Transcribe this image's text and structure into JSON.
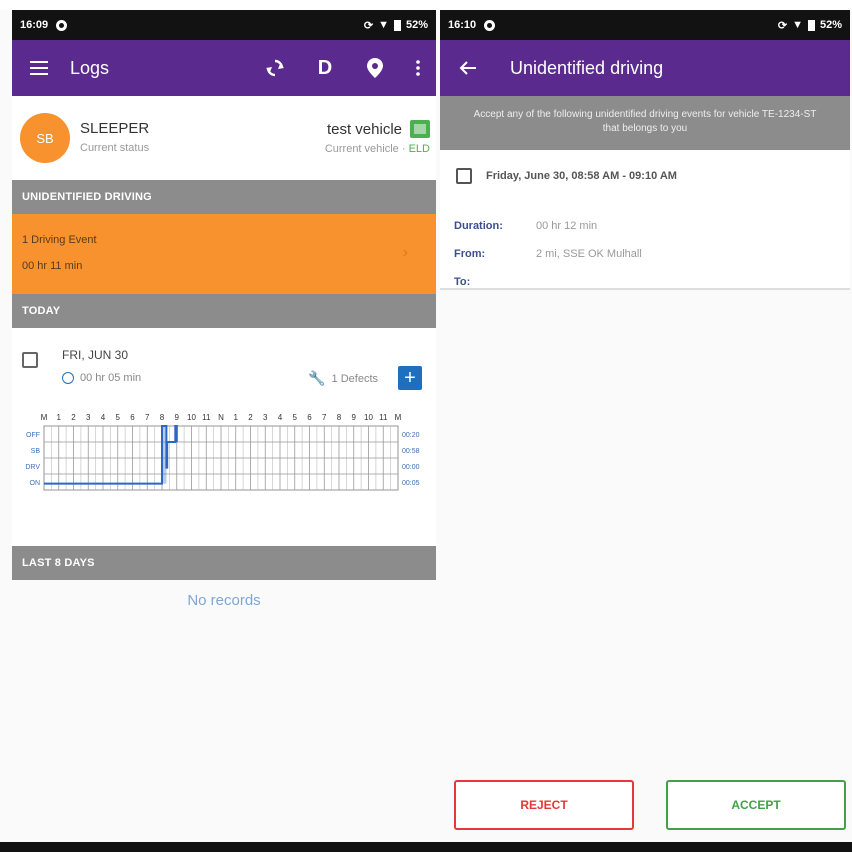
{
  "left": {
    "status_bar": {
      "time": "16:09",
      "battery": "52%"
    },
    "app_bar": {
      "title": "Logs",
      "duty_letter": "D"
    },
    "status_card": {
      "avatar_initials": "SB",
      "status": "SLEEPER",
      "status_caption": "Current status",
      "vehicle": "test vehicle",
      "vehicle_caption": "Current vehicle",
      "eld_label": "ELD"
    },
    "unidentified_section": {
      "header": "UNIDENTIFIED DRIVING",
      "event_count": "1 Driving Event",
      "event_duration": "00 hr 11 min"
    },
    "today_section": {
      "header": "TODAY",
      "date": "FRI, JUN 30",
      "duration": "00 hr 05 min",
      "defects": "1 Defects"
    },
    "log_grid": {
      "hour_labels": [
        "M",
        "1",
        "2",
        "3",
        "4",
        "5",
        "6",
        "7",
        "8",
        "9",
        "10",
        "11",
        "N",
        "1",
        "2",
        "3",
        "4",
        "5",
        "6",
        "7",
        "8",
        "9",
        "10",
        "11",
        "M"
      ],
      "rows": [
        "OFF",
        "SB",
        "DRV",
        "ON"
      ],
      "totals": [
        "00:20",
        "00:58",
        "00:00",
        "00:05"
      ]
    },
    "last8_section": {
      "header": "LAST 8 DAYS",
      "empty_text": "No records"
    }
  },
  "right": {
    "status_bar": {
      "time": "16:10",
      "battery": "52%"
    },
    "app_bar": {
      "title": "Unidentified driving"
    },
    "banner": "Accept any of the following unidentified driving events for vehicle TE-1234-ST that belongs to you",
    "event": {
      "title": "Friday, June 30, 08:58 AM - 09:10 AM",
      "duration_label": "Duration:",
      "duration_value": "00 hr 12 min",
      "from_label": "From:",
      "from_value": "2 mi, SSE OK Mulhall",
      "to_label": "To:"
    },
    "reject_label": "REJECT",
    "accept_label": "ACCEPT"
  },
  "colors": {
    "appbar": "#5b2a8e",
    "orange": "#f7922e",
    "section_gray": "#8c8c8c",
    "blue": "#1f6fbf",
    "reject": "#e53935",
    "accept": "#43a047"
  }
}
